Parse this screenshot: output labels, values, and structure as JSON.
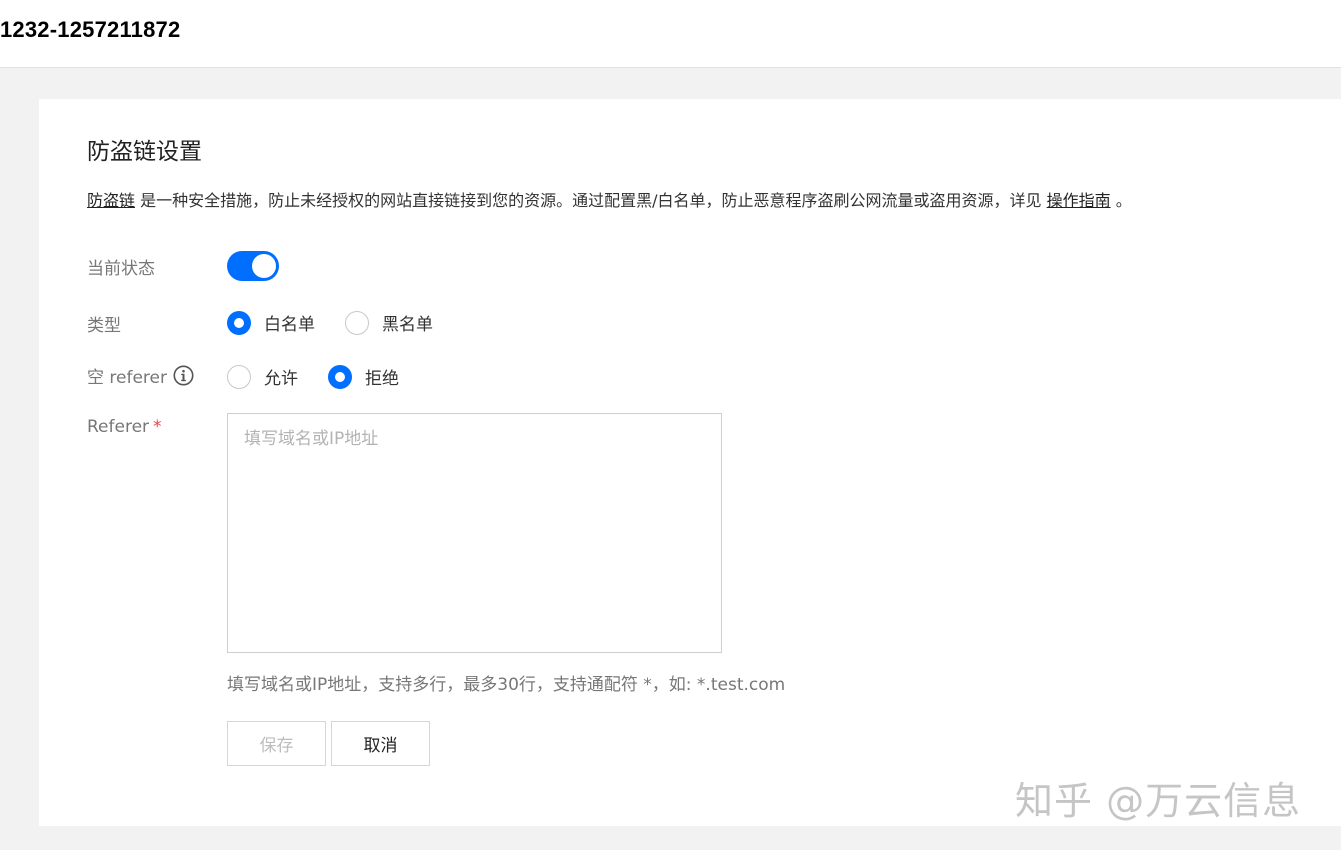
{
  "header": {
    "bucket_name": "1232-1257211872"
  },
  "panel": {
    "title": "防盗链设置",
    "description": {
      "link1": "防盗链",
      "text": " 是一种安全措施，防止未经授权的网站直接链接到您的资源。通过配置黑/白名单，防止恶意程序盗刷公网流量或盗用资源，详见 ",
      "link2": "操作指南",
      "suffix": " 。"
    },
    "status": {
      "label": "当前状态",
      "enabled": true
    },
    "type": {
      "label": "类型",
      "options": [
        {
          "label": "白名单",
          "selected": true
        },
        {
          "label": "黑名单",
          "selected": false
        }
      ]
    },
    "empty_referer": {
      "label": "空 referer",
      "icon": "info-icon",
      "options": [
        {
          "label": "允许",
          "selected": false
        },
        {
          "label": "拒绝",
          "selected": true
        }
      ]
    },
    "referer": {
      "label": "Referer",
      "required_mark": "*",
      "placeholder": "填写域名或IP地址",
      "value": "",
      "hint": "填写域名或IP地址，支持多行，最多30行，支持通配符 *，如: *.test.com"
    },
    "buttons": {
      "save": "保存",
      "cancel": "取消"
    }
  },
  "watermark": "知乎 @万云信息",
  "colors": {
    "accent": "#006eff",
    "required": "#e54545"
  }
}
